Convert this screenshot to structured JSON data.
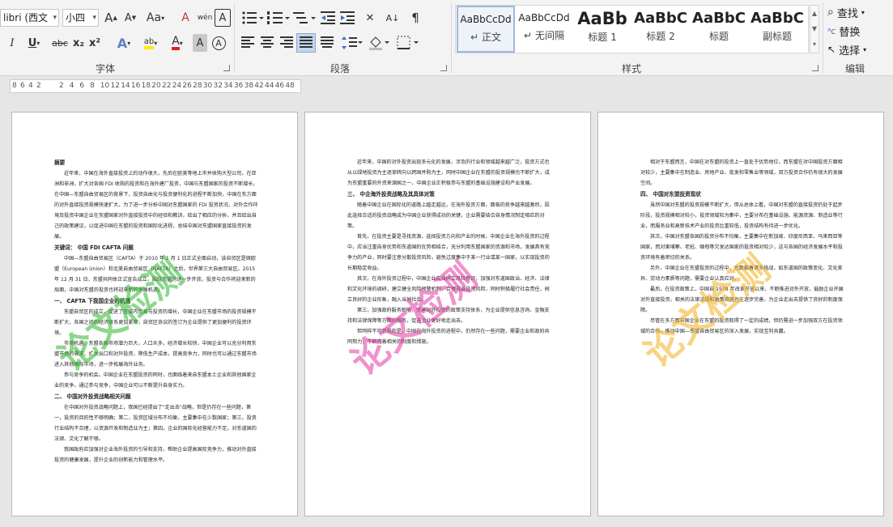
{
  "font": {
    "family": "libri (西文",
    "size": "小四"
  },
  "groups": {
    "font": "字体",
    "paragraph": "段落",
    "styles": "样式",
    "editing": "编辑"
  },
  "font_buttons": {
    "grow": "A",
    "shrink": "A",
    "case": "Aa",
    "clear": "A",
    "phonetic": "wén",
    "border_char": "A",
    "bold": "I",
    "underline": "U",
    "strike": "abc",
    "sub": "x₂",
    "sup": "x²",
    "effects": "A",
    "highlight": "ab",
    "color": "A",
    "shade": "A",
    "circle": "A"
  },
  "styles": [
    {
      "preview": "AaBbCcDd",
      "name": "正文",
      "big": false,
      "bold": false
    },
    {
      "preview": "AaBbCcDd",
      "name": "无间隔",
      "big": false,
      "bold": false
    },
    {
      "preview": "AaBb",
      "name": "标题 1",
      "big": true,
      "bold": true
    },
    {
      "preview": "AaBbC",
      "name": "标题 2",
      "big": true,
      "bold": true
    },
    {
      "preview": "AaBbC",
      "name": "标题",
      "big": true,
      "bold": true
    },
    {
      "preview": "AaBbC",
      "name": "副标题",
      "big": true,
      "bold": true
    }
  ],
  "style_prefix": "↵",
  "editing": {
    "find": "查找",
    "replace": "替换",
    "select": "选择"
  },
  "ruler": [
    "8",
    "6",
    "4",
    "2",
    "2",
    "4",
    "6",
    "8",
    "10",
    "12",
    "14",
    "16",
    "18",
    "20",
    "22",
    "24",
    "26",
    "28",
    "30",
    "32",
    "34",
    "36",
    "38",
    "42",
    "44",
    "46",
    "48"
  ],
  "pages": [
    {
      "blocks": [
        {
          "t": "h",
          "text": "摘要"
        },
        {
          "t": "p",
          "text": "近年来，中国在海外直接投资上的动作很大，先后在欧美等地上市并收购大型公司，在亚洲和非洲，扩大对各国 FDI 收购的投资和在海外建厂投资，中国与东盟国家的投资不断增长，在中国—东盟自由贸易区的背景下，投资自由化与投资便利化的进程不断加快，中国在东方面的对外直接投资规模快速扩大，为了进一步分析中国对东盟国家的 FDI 投资状况，对外合作环境及投资中国企业在东盟国家对外直接投资中的经验和教训，给出了相应的分析，并且给出自己的政策建议，以促进中国在东盟的投资和国际化进程，总结中国对东盟国家直接投资的发展。"
        },
        {
          "t": "h",
          "text": "关键词： 中国    FDI    CAFTA    问题"
        },
        {
          "t": "p",
          "text": "中国—东盟自由贸易区（CAFTA）于 2010 年 1 月 1 日正式全面启动，该自贸区是继欧盟（European Union）和北美自由贸易区（NAFTA）之后，世界第三大自由贸易区。2015 年 12 月 31 日，东盟共同体正式宣告成立，围绕东盟的进一步开放，投资与合作将迎来新的局面，中国对东盟的投资也将迎来新的发展机遇。"
        },
        {
          "t": "h",
          "text": "一、 CAFTA 下我国企业的机遇"
        },
        {
          "t": "p",
          "text": "东盟自贸区的成立，促进了区域内贸易与投资的增长，中国企业在东盟市场的投资规模不断扩大，各国之间的经济联系更加紧密，自贸区协议的签订为企业提供了更加便利的投资环境。"
        },
        {
          "t": "p",
          "text": "市场机遇。东盟各国市场潜力巨大，人口众多，经济增长较快，中国企业可以充分利用东盟市场的需求，扩大出口和对外投资，降低生产成本，提高竞争力，同时也可以通过东盟市场进入其他国际市场，进一步拓展海外业务。"
        },
        {
          "t": "p",
          "text": "参与竞争的机会。中国企业在东盟投资的同时，也面临着来自东盟本土企业和其他国家企业的竞争，通过参与竞争，中国企业可以不断提升自身实力。"
        },
        {
          "t": "h",
          "text": "二、 中国对外投资战略相关问题"
        },
        {
          "t": "p",
          "text": "在中国对外投资战略问题上，我国已经提出了\"走出去\"战略，但是仍存在一些问题，第一，投资的目的性不够明确；第二，投资区域分布不均衡，主要集中在少数国家；第三，投资行业结构不合理，以资源开发和制造业为主；第四，企业的国际化经营能力不足，对东道国的法律、文化了解不够。"
        },
        {
          "t": "p",
          "text": "我国政府应加强对企业海外投资的引导和支持，帮助企业提高国际竞争力，推动对外直接投资的健康发展，提升企业的创新能力和管理水平。"
        }
      ]
    },
    {
      "blocks": [
        {
          "t": "p",
          "text": "近年来，中国的对外投资出现多元化的发展，涉及的行业和领域越来越广泛，投资方式也从以绿地投资为主逐渐转向以跨国并购为主，同时中国企业在东盟的投资规模也不断扩大，成为东盟重要的外资来源国之一，中国企业正积极参与东盟的基础设施建设和产业发展。"
        },
        {
          "t": "h",
          "text": "三、 中企海外投资战略及其具体对策"
        },
        {
          "t": "p",
          "text": "随着中国企业在国际化的道路上越走越远，在海外投资方面，面临的竞争越来越激烈，因此选择合适的投资战略成为中国企业获得成功的关键，企业需要结合自身情况制定相应的对策。"
        },
        {
          "t": "p",
          "text": "首先，在投资主要是寻找资源，选择投资方向和产业的时候，中国企业在海外投资的过程中，应当注重自身优势和东道国的优势相结合，充分利用东盟国家的资源和市场，发展具有竞争力的产业，同时要注意分散投资风险，避免过度集中于某一行业或某一国家，以实现投资的长期稳定收益。"
        },
        {
          "t": "p",
          "text": "其次，在海外投资过程中，中国企业应当树立风险意识，加强对东道国政治、经济、法律和文化环境的调研，建立健全风险预警机制，合理规避投资风险，同时积极履行社会责任，树立良好的企业形象，融入当地社会。"
        },
        {
          "t": "p",
          "text": "第三，加强政府服务职能，完善对外投资的政策支持体系，为企业提供信息咨询、金融支持和法律保障等方面的服务，促进企业更好地走出去。"
        },
        {
          "t": "p",
          "text": "但同样不可忽视的是，中国在海外投资的进程中，仍然存在一些问题，需要企业和政府共同努力，不断完善相关的制度和措施。"
        }
      ]
    },
    {
      "blocks": [
        {
          "t": "p",
          "text": "相对于东盟而言，中国在对东盟的投资上一直处于优势地位，而东盟在对中国投资方面相对较少，主要集中在制造业、房地产业、批发和零售业等领域，双方投资合作仍有很大的发展空间。"
        },
        {
          "t": "h",
          "text": "四、 中国对东盟投资现状"
        },
        {
          "t": "p",
          "text": "虽然中国对东盟的投资规模不断扩大，但从总体上看，中国对东盟的直接投资仍处于起步阶段，投资规模相对较小，投资领域较为集中，主要分布在基础设施、能源资源、制造业等行业，而服务业和高新技术产业的投资比重较低，投资结构有待进一步优化。"
        },
        {
          "t": "p",
          "text": "其次，中国对东盟各国的投资分布不均衡，主要集中在新加坡、印度尼西亚、马来西亚等国家，而对柬埔寨、老挝、缅甸等欠发达国家的投资相对较少，这与各国的经济发展水平和投资环境有着密切的关系。"
        },
        {
          "t": "p",
          "text": "另外，中国企业在东盟投资的过程中，也面临着诸多挑战，如东道国的政策变化、文化差异、劳动力素质等问题，需要企业认真应对。"
        },
        {
          "t": "p",
          "text": "最后，在投资政策上，中国自 1978 年改革开放以来，不断推进对外开放，鼓励企业开展对外直接投资，相关的法律法规和政策措施也在逐步完善，为企业走出去提供了良好的制度保障。"
        },
        {
          "t": "p",
          "text": "尽管在多方面中国企业在东盟的投资取得了一定的成绩，但仍需进一步加强双方在投资领域的合作，推动中国—东盟自由贸易区的深入发展，实现互利共赢。"
        }
      ]
    }
  ],
  "watermarks": [
    {
      "text": "论文检测",
      "color": "#2fb82f"
    },
    {
      "text": "论文检测",
      "color": "#e23aa3"
    },
    {
      "text": "论文检测",
      "color": "#f2b01e"
    }
  ]
}
